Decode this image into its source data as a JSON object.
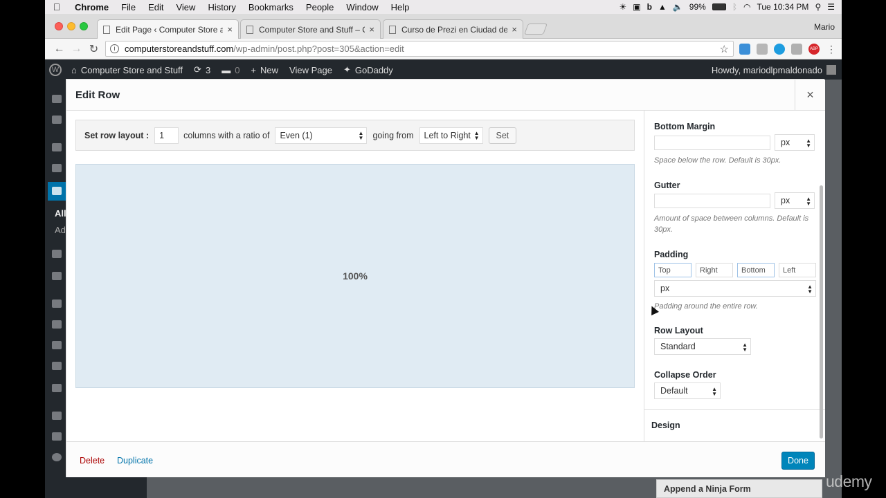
{
  "menubar": {
    "apple": "",
    "items": [
      "Chrome",
      "File",
      "Edit",
      "View",
      "History",
      "Bookmarks",
      "People",
      "Window",
      "Help"
    ],
    "battery": "99%",
    "clock": "Tue 10:34 PM"
  },
  "browser": {
    "tabs": [
      {
        "label": "Edit Page ‹ Computer Store and Stuff",
        "close": "×"
      },
      {
        "label": "Computer Store and Stuff – Computer",
        "close": "×"
      },
      {
        "label": "Curso de Prezi en Ciudad de México",
        "close": "×"
      }
    ],
    "profile": "Mario",
    "back": "←",
    "forward": "→",
    "reload": "↻",
    "url_host": "computerstoreandstuff.com",
    "url_path": "/wp-admin/post.php?post=305&action=edit",
    "star": "☆",
    "ext_abp": "ABP"
  },
  "adminbar": {
    "site_name": "Computer Store and Stuff",
    "updates": "3",
    "comments": "0",
    "new": "New",
    "view_page": "View Page",
    "godaddy": "GoDaddy",
    "howdy": "Howdy, mariodlpmaldonado"
  },
  "sidebar": {
    "all": "All",
    "add": "Ad"
  },
  "modal": {
    "title": "Edit Row",
    "close": "×",
    "layout": {
      "label": "Set row layout :",
      "columns_value": "1",
      "ratio_text": "columns with a ratio of",
      "ratio_value": "Even (1)",
      "going_text": "going from",
      "direction_value": "Left to Right",
      "set_button": "Set"
    },
    "cell_label": "100%",
    "settings": {
      "bottom_margin": {
        "label": "Bottom Margin",
        "value": "",
        "unit": "px",
        "help": "Space below the row. Default is 30px."
      },
      "gutter": {
        "label": "Gutter",
        "value": "",
        "unit": "px",
        "help": "Amount of space between columns. Default is 30px."
      },
      "padding": {
        "label": "Padding",
        "top": "Top",
        "right": "Right",
        "bottom": "Bottom",
        "left": "Left",
        "unit": "px",
        "help": "Padding around the entire row."
      },
      "row_layout": {
        "label": "Row Layout",
        "value": "Standard"
      },
      "collapse_order": {
        "label": "Collapse Order",
        "value": "Default"
      },
      "design": "Design"
    },
    "footer": {
      "delete": "Delete",
      "duplicate": "Duplicate",
      "done": "Done"
    }
  },
  "background": {
    "ninja_form": "Append a Ninja Form"
  },
  "watermark": "udemy"
}
